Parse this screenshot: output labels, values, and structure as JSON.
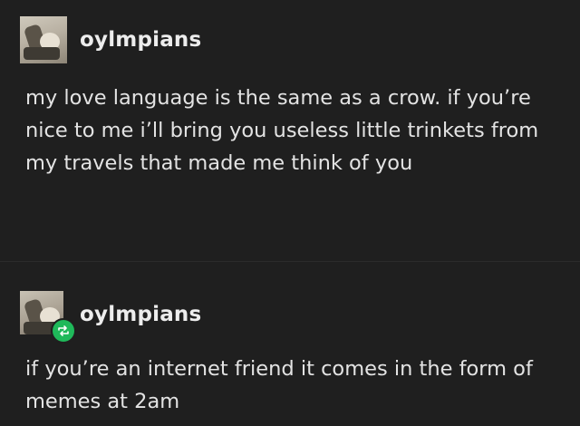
{
  "posts": [
    {
      "username": "oylmpians",
      "text": "my love language is the same as a crow. if you’re nice to me i’ll bring you useless little trinkets from my travels that made me think of you",
      "reblog": false
    },
    {
      "username": "oylmpians",
      "text": "if you’re an internet friend it comes in the form of memes at 2am",
      "reblog": true
    }
  ],
  "colors": {
    "background": "#1f1f1f",
    "text": "#e3e3e3",
    "reblog_badge": "#1fb95a"
  },
  "icons": {
    "reblog_badge": "reblog-icon",
    "avatar": "avatar"
  }
}
